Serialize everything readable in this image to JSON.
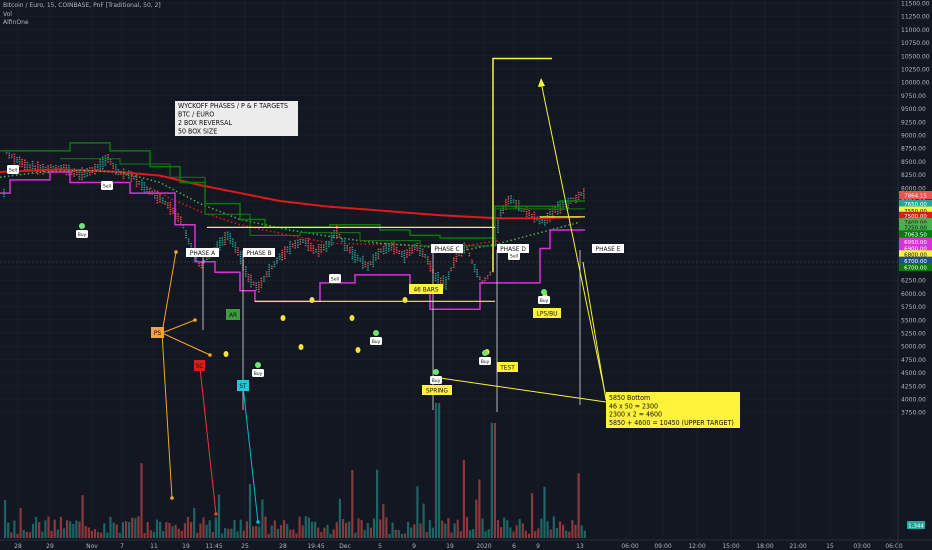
{
  "header": {
    "symbol_line": "Bitcoin / Euro, 15, COINBASE, PnF [Traditional, 50, 2]",
    "indicator_1": "Vol",
    "indicator_2": "AlfinOne"
  },
  "colors": {
    "background": "#131722",
    "grid": "#1e2230",
    "axis_text": "#b2b5be",
    "candle_green": "#26a69a",
    "candle_red": "#ef5350",
    "ema_red": "#e01919",
    "ema_green_dotted": "#4caf50",
    "band_green": "#0b7a0b",
    "band_magenta": "#d633d6",
    "yellow_line": "#f5f53a",
    "annotation_yellow": "#fff23a",
    "annotation_white": "#ffffff"
  },
  "chart_data": {
    "type": "pnf",
    "y_axis_labels": [
      "11500.00",
      "11250.00",
      "11000.00",
      "10750.00",
      "10500.00",
      "10250.00",
      "10000.00",
      "9750.00",
      "9500.00",
      "9250.00",
      "9000.00",
      "8750.00",
      "8500.00",
      "8250.00",
      "8000.00",
      "7750.00",
      "7500.00",
      "7250.00",
      "7000.00",
      "6750.00",
      "6500.00",
      "6250.00",
      "6000.00",
      "5750.00",
      "5500.00",
      "5250.00",
      "5000.00",
      "4750.00",
      "4500.00",
      "4250.00",
      "4000.00",
      "3750.00"
    ],
    "ylim": [
      3500,
      11600
    ],
    "x_tick_labels": [
      "28",
      "29",
      "Nov",
      "7",
      "11",
      "19",
      "11:45",
      "25",
      "28",
      "19:45",
      "Dec",
      "5",
      "9",
      "19",
      "2020",
      "6",
      "9",
      "13",
      "06:00",
      "09:00",
      "12:00",
      "15:00",
      "18:00",
      "21:00",
      "15",
      "03:00",
      "06:00"
    ],
    "price_tags": [
      {
        "label": "7864.15",
        "value": 7864,
        "color": "#ef5350"
      },
      {
        "label": "7650.00",
        "value": 7700,
        "color": "#26a69a"
      },
      {
        "label": "7550.00",
        "value": 7570,
        "color": "#f5f53a"
      },
      {
        "label": "7500.00",
        "value": 7470,
        "color": "#e01919"
      },
      {
        "label": "7400.00",
        "value": 7350,
        "color": "#4caf50"
      },
      {
        "label": "7250.00",
        "value": 7250,
        "color": "#4caf50"
      },
      {
        "label": "7063.50",
        "value": 7120,
        "color": "#0b7a0b"
      },
      {
        "label": "6950.00",
        "value": 6980,
        "color": "#d633d6"
      },
      {
        "label": "6900.00",
        "value": 6860,
        "color": "#d633d6"
      },
      {
        "label": "6800.00",
        "value": 6740,
        "color": "#f5f53a"
      },
      {
        "label": "6700.00",
        "value": 6620,
        "color": "#1f4f8f"
      },
      {
        "label": "6700.00",
        "value": 6500,
        "color": "#0b7a0b"
      }
    ],
    "volume_tag": "1,344",
    "levels": {
      "high": 10450,
      "bottom": 5850,
      "range_top": 7250,
      "range_bottom": 5850
    },
    "annotations": {
      "title_box": [
        "WYCKOFF PHASES / P & F TARGETS",
        "BTC / EURO",
        "2 BOX REVERSAL",
        "50 BOX SIZE"
      ],
      "target_box": [
        "5850 Bottom",
        "46 x 50 = 2300",
        "2300 x 2 = 4600",
        "5850 + 4600 = 10450 (UPPER TARGET)"
      ],
      "phases": [
        "PHASE A",
        "PHASE B",
        "PHASE C",
        "PHASE D",
        "PHASE E"
      ],
      "events": [
        "PS",
        "SC",
        "AR",
        "ST",
        "SPRING",
        "TEST",
        "LPS/BU",
        "46 BARS"
      ],
      "signals": [
        "Sell",
        "Buy"
      ]
    }
  }
}
